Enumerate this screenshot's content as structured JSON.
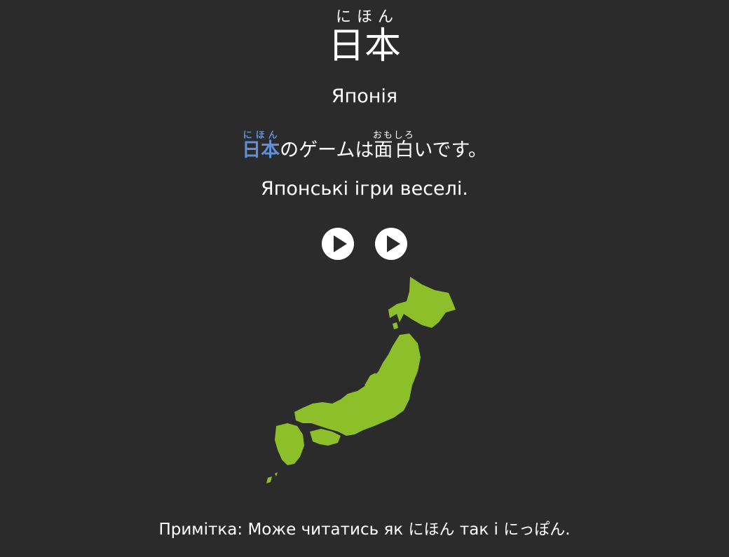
{
  "word": {
    "reading": "にほん",
    "kanji": "日本",
    "translation": "Японія"
  },
  "sentence": {
    "word_kanji": "日本",
    "word_reading": "にほん",
    "part1": "のゲームは",
    "kanji2": "面白",
    "kanji2_reading": "おもしろ",
    "part2": "いです。",
    "translation": "Японські ігри веселі."
  },
  "note": {
    "prefix": "Примітка: Може читатись як",
    "reading1": "にほん",
    "middle": "так і",
    "reading2": "にっぽん",
    "suffix": "."
  },
  "colors": {
    "background": "#2b2b2b",
    "highlight": "#5f8fd6",
    "map_green": "#8dbf2a",
    "text": "#ffffff"
  },
  "icons": {
    "play_word": "play-icon",
    "play_sentence": "play-icon",
    "map": "japan-map-illustration"
  }
}
